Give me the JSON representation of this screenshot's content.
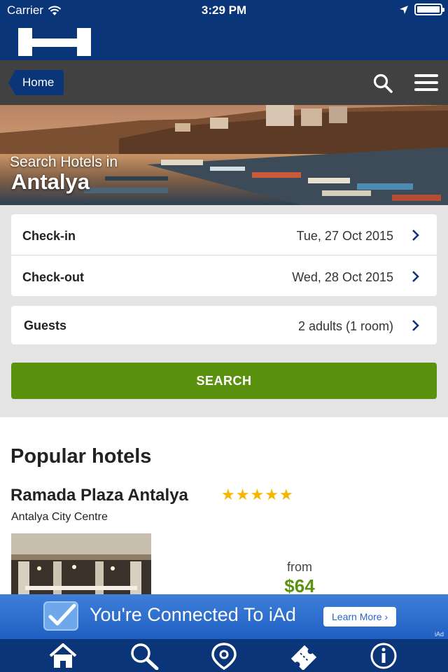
{
  "status_bar": {
    "carrier": "Carrier",
    "time": "3:29 PM"
  },
  "nav": {
    "home_label": "Home"
  },
  "hero": {
    "subtitle": "Search Hotels in",
    "city": "Antalya"
  },
  "form": {
    "checkin_label": "Check-in",
    "checkin_value": "Tue, 27 Oct 2015",
    "checkout_label": "Check-out",
    "checkout_value": "Wed, 28 Oct 2015",
    "guests_label": "Guests",
    "guests_value": "2 adults (1 room)",
    "search_label": "SEARCH"
  },
  "popular": {
    "heading": "Popular hotels",
    "hotel": {
      "name": "Ramada Plaza Antalya",
      "stars": 5,
      "location": "Antalya City Centre",
      "from_label": "from",
      "price": "$64"
    }
  },
  "ad": {
    "message": "You're Connected To iAd",
    "button_label": "Learn More ›",
    "tag": "iAd"
  },
  "tabs": [
    "home-icon",
    "search-icon",
    "location-pin-icon",
    "ticket-icon",
    "info-icon"
  ],
  "colors": {
    "brand_blue": "#0a3578",
    "nav_gray": "#414141",
    "search_green": "#5a920f",
    "star_yellow": "#f7b500",
    "ad_blue": "#2f6fd0"
  }
}
